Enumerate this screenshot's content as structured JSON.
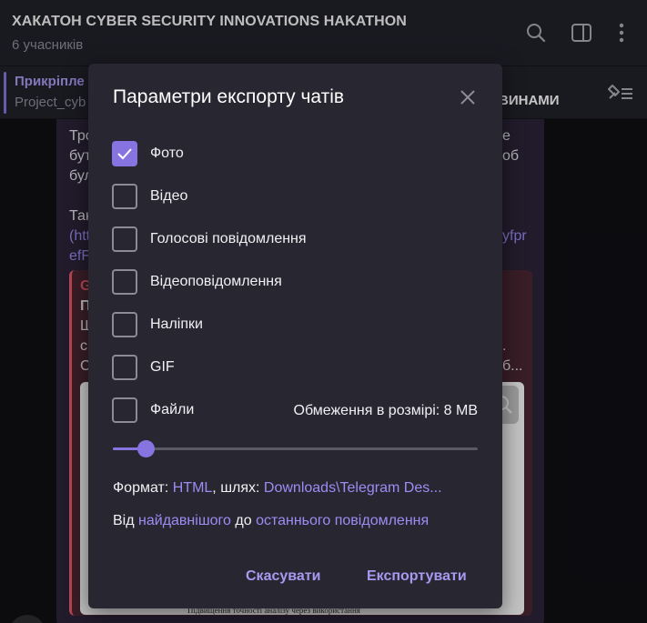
{
  "header": {
    "title": "ХАКАТОН CYBER SECURITY INNOVATIONS HAKATHON",
    "subtitle": "6 учасників",
    "icons": [
      "search-icon",
      "sidebar-toggle-icon",
      "more-vertical-icon"
    ]
  },
  "pinned": {
    "title": "Прикріпле",
    "subtitle": "Project_cyb",
    "button_label": "ВИНАМИ",
    "icon": "pin-list-icon"
  },
  "background_message": {
    "lines": [
      "Тро",
      "бут",
      "бул",
      "Так",
      "(htt",
      "efF",
      "е",
      "об",
      "yfpr"
    ],
    "quote_lines": [
      "G",
      "П",
      "Ш",
      "с",
      "С",
      ".",
      "б..."
    ],
    "preview_footer": "Підвищення точності аналізу через використання"
  },
  "modal": {
    "title": "Параметри експорту чатів",
    "options": [
      {
        "label": "Фото",
        "checked": true
      },
      {
        "label": "Відео",
        "checked": false
      },
      {
        "label": "Голосові повідомлення",
        "checked": false
      },
      {
        "label": "Відеоповідомлення",
        "checked": false
      },
      {
        "label": "Наліпки",
        "checked": false
      },
      {
        "label": "GIF",
        "checked": false
      },
      {
        "label": "Файли",
        "checked": false
      }
    ],
    "size_limit": "Обмеження в розмірі: 8 MB",
    "slider_value": 0.09,
    "format": {
      "prefix": "Формат: ",
      "format_value": "HTML",
      "path_prefix": ", шлях: ",
      "path_value": "Downloads\\Telegram Des..."
    },
    "range": {
      "from_prefix": "Від ",
      "from_value": "найдавнішого",
      "to_prefix": " до ",
      "to_value": "останнього повідомлення"
    },
    "cancel_label": "Скасувати",
    "export_label": "Експортувати"
  },
  "colors": {
    "accent": "#8774e1",
    "link": "#9e8cf5",
    "modal_bg": "#282731",
    "header_bg": "#212129"
  }
}
